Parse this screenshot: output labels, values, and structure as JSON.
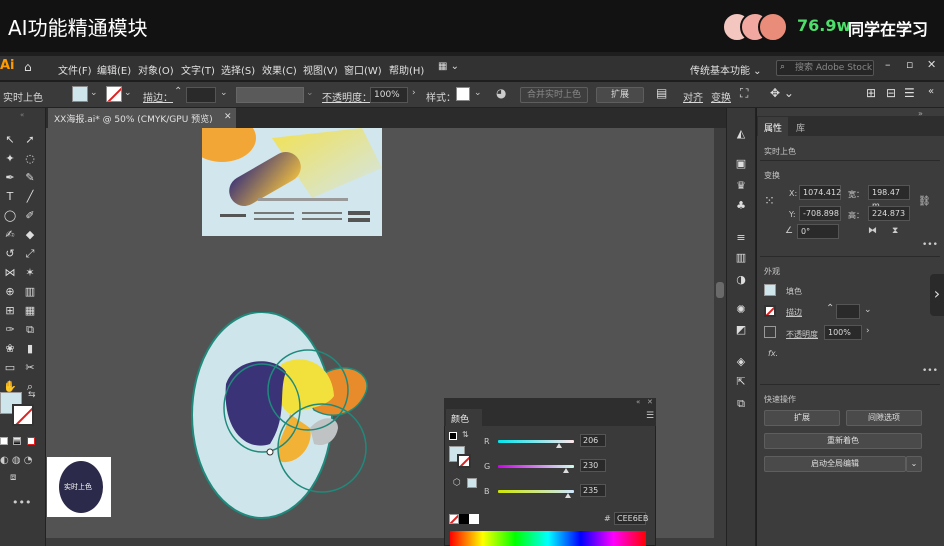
{
  "banner": {
    "title": "AI功能精通模块",
    "viewer_count": "76.9w",
    "viewer_label": "同学在学习",
    "accent_color": "#4ddf6a"
  },
  "menubar": {
    "logo": "Ai",
    "items": [
      "文件(F)",
      "编辑(E)",
      "对象(O)",
      "文字(T)",
      "选择(S)",
      "效果(C)",
      "视图(V)",
      "窗口(W)",
      "帮助(H)"
    ],
    "workspace": "传统基本功能",
    "search_placeholder": "搜索 Adobe Stock"
  },
  "control_bar": {
    "mode_label": "实时上色",
    "stroke_label": "描边：",
    "opacity_label": "不透明度：",
    "opacity_value": "100%",
    "style_label": "样式：",
    "merge_button": "合并实时上色",
    "expand_button": "扩展",
    "align_label": "对齐",
    "transform_label": "变换"
  },
  "document": {
    "tab_title": "XX海报.ai* @ 50% (CMYK/GPU 预览)"
  },
  "properties": {
    "tabs": [
      "属性",
      "库"
    ],
    "selection_type": "实时上色",
    "transform_title": "变换",
    "x_label": "X:",
    "x_value": "1074.412",
    "y_label": "Y:",
    "y_value": "-708.898",
    "w_label": "宽：",
    "w_value": "198.47 m",
    "h_label": "高：",
    "h_value": "224.873",
    "angle_value": "0°",
    "appearance_title": "外观",
    "fill_label": "填色",
    "stroke_label": "描边",
    "opacity_label": "不透明度",
    "opacity_value": "100%",
    "fx_label": "fx.",
    "quick_actions_title": "快速操作",
    "expand_button": "扩展",
    "release_button": "间隙选项",
    "recolor_button": "重新着色",
    "global_edit_button": "启动全局编辑"
  },
  "color_panel": {
    "tab": "颜色",
    "r_label": "R",
    "r_value": "206",
    "g_label": "G",
    "g_value": "230",
    "b_label": "B",
    "b_value": "235",
    "hex_label": "#",
    "hex_value": "CEE6EB",
    "fill_color": "#cee6eb"
  },
  "thumbnail": {
    "label": "实时上色"
  },
  "colors": {
    "navy": "#3b3378",
    "yellow": "#f2e03c",
    "orange": "#e88b2a",
    "gold": "#f2b236",
    "light_blue": "#cee6eb",
    "teal_stroke": "#1f8a7c"
  }
}
